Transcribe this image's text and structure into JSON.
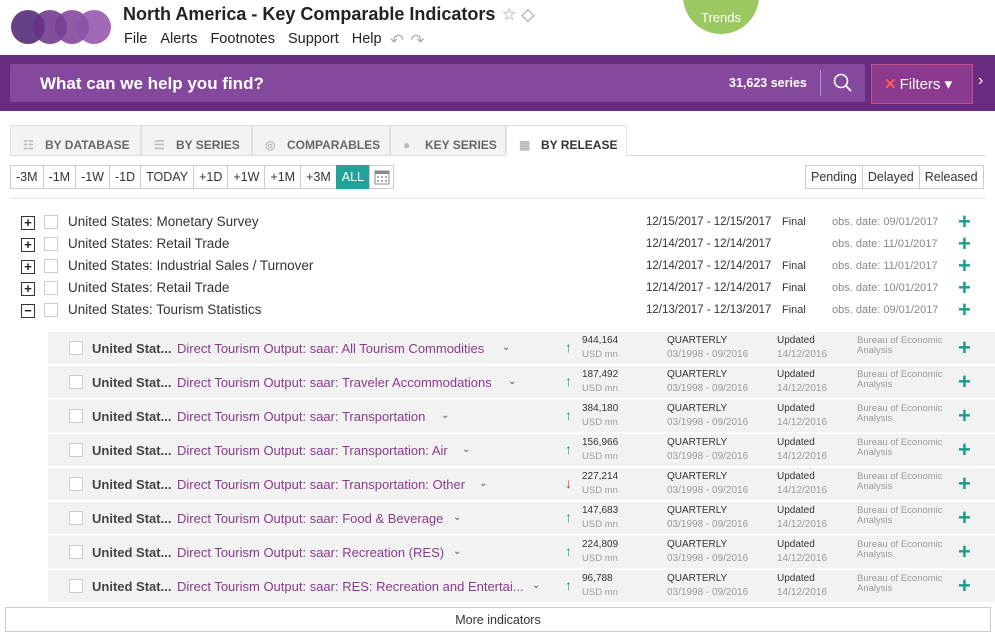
{
  "header": {
    "title": "North America - Key Comparable Indicators",
    "star_icon": "star-icon",
    "tag_icon": "tag-icon",
    "menu": [
      "File",
      "Alerts",
      "Footnotes",
      "Support",
      "Help"
    ],
    "trends_label": "Trends",
    "logo_colors": [
      "#5a2a78",
      "#6d3a8a",
      "#8a4aa2",
      "#9c5cb4"
    ]
  },
  "search": {
    "placeholder": "What can we help you find?",
    "count": "31,623 series",
    "filters_label": "Filters"
  },
  "tabs": [
    {
      "label": "BY DATABASE",
      "icon": "database-tree-icon"
    },
    {
      "label": "BY SERIES",
      "icon": "list-icon"
    },
    {
      "label": "COMPARABLES",
      "icon": "globe-icon"
    },
    {
      "label": "KEY SERIES",
      "icon": "key-circle-icon"
    },
    {
      "label": "BY RELEASE",
      "icon": "calendar-icon"
    }
  ],
  "ranges": [
    "-3M",
    "-1M",
    "-1W",
    "-1D",
    "TODAY",
    "+1D",
    "+1W",
    "+1M",
    "+3M",
    "ALL"
  ],
  "active_range": "ALL",
  "status_buttons": [
    "Pending",
    "Delayed",
    "Released"
  ],
  "releases": [
    {
      "toggle": "+",
      "name": "United States: Monetary Survey",
      "dates": "12/15/2017 - 12/15/2017",
      "final": "Final",
      "obs": "obs. date: 09/01/2017"
    },
    {
      "toggle": "+",
      "name": "United States: Retail Trade",
      "dates": "12/14/2017 - 12/14/2017",
      "final": "",
      "obs": "obs. date: 11/01/2017"
    },
    {
      "toggle": "+",
      "name": "United States: Industrial Sales / Turnover",
      "dates": "12/14/2017 - 12/14/2017",
      "final": "Final",
      "obs": "obs. date: 11/01/2017"
    },
    {
      "toggle": "+",
      "name": "United States: Retail Trade",
      "dates": "12/14/2017 - 12/14/2017",
      "final": "Final",
      "obs": "obs. date: 10/01/2017"
    },
    {
      "toggle": "−",
      "name": "United States: Tourism Statistics",
      "dates": "12/13/2017 - 12/13/2017",
      "final": "Final",
      "obs": "obs. date: 09/01/2017"
    }
  ],
  "series": [
    {
      "region": "United Stat...",
      "name": "Direct Tourism Output: saar: All Tourism Commodities",
      "trend": "up",
      "value": "944,164",
      "unit": "USD mn",
      "freq": "QUARTERLY",
      "range": "03/1998 - 09/2016",
      "status": "Updated",
      "updated": "14/12/2016",
      "source": "Bureau of Economic Analysis"
    },
    {
      "region": "United Stat...",
      "name": "Direct Tourism Output: saar: Traveler Accommodations",
      "trend": "up",
      "value": "187,492",
      "unit": "USD mn",
      "freq": "QUARTERLY",
      "range": "03/1998 - 09/2016",
      "status": "Updated",
      "updated": "14/12/2016",
      "source": "Bureau of Economic Analysis"
    },
    {
      "region": "United Stat...",
      "name": "Direct Tourism Output: saar: Transportation",
      "trend": "up",
      "value": "384,180",
      "unit": "USD mn",
      "freq": "QUARTERLY",
      "range": "03/1998 - 09/2016",
      "status": "Updated",
      "updated": "14/12/2016",
      "source": "Bureau of Economic Analysis"
    },
    {
      "region": "United Stat...",
      "name": "Direct Tourism Output: saar: Transportation: Air",
      "trend": "up",
      "value": "156,966",
      "unit": "USD mn",
      "freq": "QUARTERLY",
      "range": "03/1998 - 09/2016",
      "status": "Updated",
      "updated": "14/12/2016",
      "source": "Bureau of Economic Analysis"
    },
    {
      "region": "United Stat...",
      "name": "Direct Tourism Output: saar: Transportation: Other",
      "trend": "down",
      "value": "227,214",
      "unit": "USD mn",
      "freq": "QUARTERLY",
      "range": "03/1998 - 09/2016",
      "status": "Updated",
      "updated": "14/12/2016",
      "source": "Bureau of Economic Analysis"
    },
    {
      "region": "United Stat...",
      "name": "Direct Tourism Output: saar: Food & Beverage",
      "trend": "up",
      "value": "147,683",
      "unit": "USD mn",
      "freq": "QUARTERLY",
      "range": "03/1998 - 09/2016",
      "status": "Updated",
      "updated": "14/12/2016",
      "source": "Bureau of Economic Analysis"
    },
    {
      "region": "United Stat...",
      "name": "Direct Tourism Output: saar: Recreation (RES)",
      "trend": "up",
      "value": "224,809",
      "unit": "USD mn",
      "freq": "QUARTERLY",
      "range": "03/1998 - 09/2016",
      "status": "Updated",
      "updated": "14/12/2016",
      "source": "Bureau of Economic Analysis"
    },
    {
      "region": "United Stat...",
      "name": "Direct Tourism Output: saar: RES: Recreation and Entertai...",
      "trend": "up",
      "value": "96,788",
      "unit": "USD mn",
      "freq": "QUARTERLY",
      "range": "03/1998 - 09/2016",
      "status": "Updated",
      "updated": "14/12/2016",
      "source": "Bureau of Economic Analysis"
    }
  ],
  "colors": {
    "purple": "#6a2c83",
    "accent_teal": "#1b9c8a",
    "up": "#1b9c8a",
    "down": "#d9302c",
    "trends": "#9bc860"
  },
  "more_label": "More indicators"
}
